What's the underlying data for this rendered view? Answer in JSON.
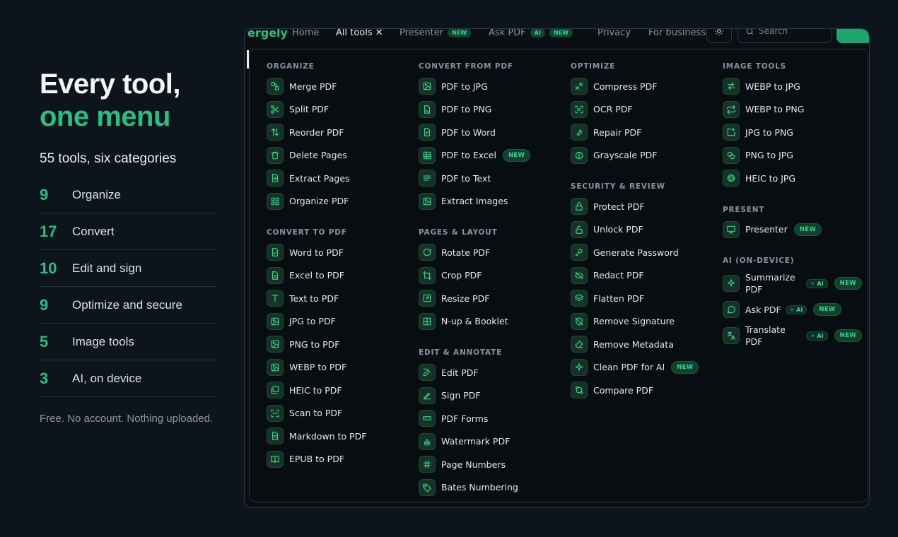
{
  "promo": {
    "title_line1": "Every tool,",
    "title_line2": "one menu",
    "subtitle": "55 tools, six categories",
    "stats": [
      {
        "num": "9",
        "label": "Organize"
      },
      {
        "num": "17",
        "label": "Convert"
      },
      {
        "num": "10",
        "label": "Edit and sign"
      },
      {
        "num": "9",
        "label": "Optimize and secure"
      },
      {
        "num": "5",
        "label": "Image tools"
      },
      {
        "num": "3",
        "label": "AI, on device"
      }
    ],
    "footnote": "Free. No account. Nothing uploaded."
  },
  "nav": {
    "logo": "ergely",
    "home": "Home",
    "all_tools": "All tools",
    "presenter": "Presenter",
    "ask_pdf": "Ask PDF",
    "privacy": "Privacy",
    "for_business": "For business",
    "search_placeholder": "Search",
    "new_badge": "NEW",
    "ai_badge": "AI"
  },
  "menu": {
    "badges": {
      "new": "NEW",
      "ai": "AI"
    },
    "organize": {
      "title": "ORGANIZE",
      "items": [
        "Merge PDF",
        "Split PDF",
        "Reorder PDF",
        "Delete Pages",
        "Extract Pages",
        "Organize PDF"
      ]
    },
    "convert_to": {
      "title": "CONVERT TO PDF",
      "items": [
        "Word to PDF",
        "Excel to PDF",
        "Text to PDF",
        "JPG to PDF",
        "PNG to PDF",
        "WEBP to PDF",
        "HEIC to PDF",
        "Scan to PDF",
        "Markdown to PDF",
        "EPUB to PDF"
      ]
    },
    "convert_from": {
      "title": "CONVERT FROM PDF",
      "items": [
        "PDF to JPG",
        "PDF to PNG",
        "PDF to Word",
        "PDF to Excel",
        "PDF to Text",
        "Extract Images"
      ]
    },
    "pages_layout": {
      "title": "PAGES & LAYOUT",
      "items": [
        "Rotate PDF",
        "Crop PDF",
        "Resize PDF",
        "N-up & Booklet"
      ]
    },
    "edit_annotate": {
      "title": "EDIT & ANNOTATE",
      "items": [
        "Edit PDF",
        "Sign PDF",
        "PDF Forms",
        "Watermark PDF",
        "Page Numbers",
        "Bates Numbering"
      ]
    },
    "optimize": {
      "title": "OPTIMIZE",
      "items": [
        "Compress PDF",
        "OCR PDF",
        "Repair PDF",
        "Grayscale PDF"
      ]
    },
    "security": {
      "title": "SECURITY & REVIEW",
      "items": [
        "Protect PDF",
        "Unlock PDF",
        "Generate Password",
        "Redact PDF",
        "Flatten PDF",
        "Remove Signature",
        "Remove Metadata",
        "Clean PDF for AI",
        "Compare PDF"
      ]
    },
    "image_tools": {
      "title": "IMAGE TOOLS",
      "items": [
        "WEBP to JPG",
        "WEBP to PNG",
        "JPG to PNG",
        "PNG to JPG",
        "HEIC to JPG"
      ]
    },
    "present": {
      "title": "PRESENT",
      "items": [
        "Presenter"
      ]
    },
    "ai": {
      "title": "AI (ON-DEVICE)",
      "items": [
        "Summarize PDF",
        "Ask PDF",
        "Translate PDF"
      ]
    }
  },
  "colors": {
    "accent": "#25c082",
    "background": "#0d141b",
    "menu_bg": "#080d12"
  }
}
